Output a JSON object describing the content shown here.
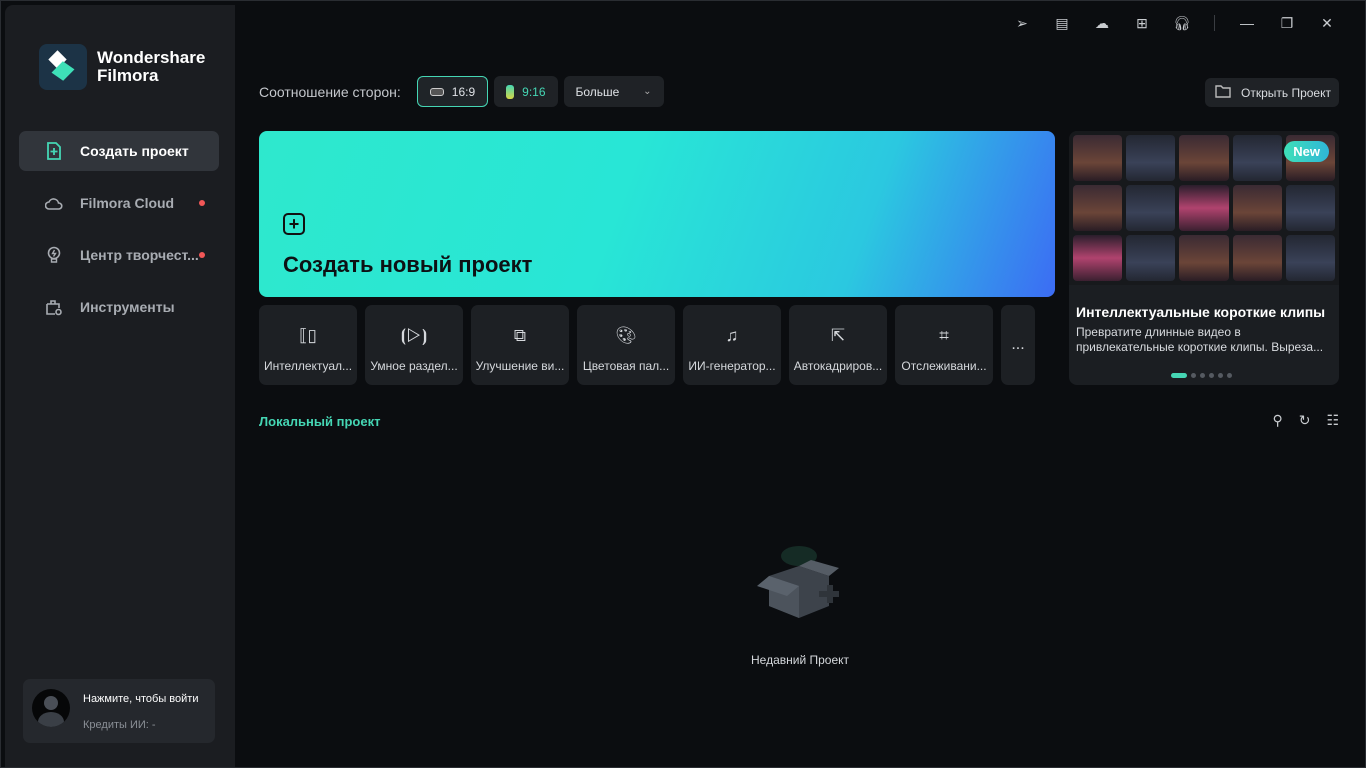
{
  "app": {
    "logo_line1": "Wondershare",
    "logo_line2": "Filmora"
  },
  "sidebar": {
    "items": [
      {
        "label": "Создать проект",
        "active": true,
        "icon": "new-project-icon"
      },
      {
        "label": "Filmora Cloud",
        "dot": true,
        "icon": "cloud-icon"
      },
      {
        "label": "Центр творчест...",
        "dot": true,
        "icon": "lightbulb-icon"
      },
      {
        "label": "Инструменты",
        "icon": "toolbox-icon"
      }
    ],
    "user": {
      "login": "Нажмите, чтобы войти",
      "credits": "Кредиты ИИ: -"
    }
  },
  "titlebar": {
    "icons": [
      "send-icon",
      "task-list-icon",
      "cloud-sync-icon",
      "apps-icon",
      "headset-icon"
    ]
  },
  "aspect": {
    "label": "Соотношение сторон:",
    "options": [
      "16:9",
      "9:16"
    ],
    "more": "Больше",
    "selected": "16:9"
  },
  "open_project": "Открыть Проект",
  "hero": {
    "title": "Создать новый проект"
  },
  "tools": [
    "Интеллектуал...",
    "Умное раздел...",
    "Улучшение ви...",
    "Цветовая пал...",
    "ИИ-генератор...",
    "Автокадриров...",
    "Отслеживани..."
  ],
  "more_tools": "...",
  "promo": {
    "badge": "New",
    "title": "Интеллектуальные короткие клипы",
    "desc": "Превратите длинные видео в привлекательные короткие клипы. Выреза...",
    "slides": 6,
    "current_slide": 1
  },
  "local": {
    "title": "Локальный проект",
    "empty": "Недавний Проект"
  },
  "colors": {
    "accent": "#45d6b4",
    "sidebar": "#1b1d21",
    "bg": "#0b0d10"
  }
}
